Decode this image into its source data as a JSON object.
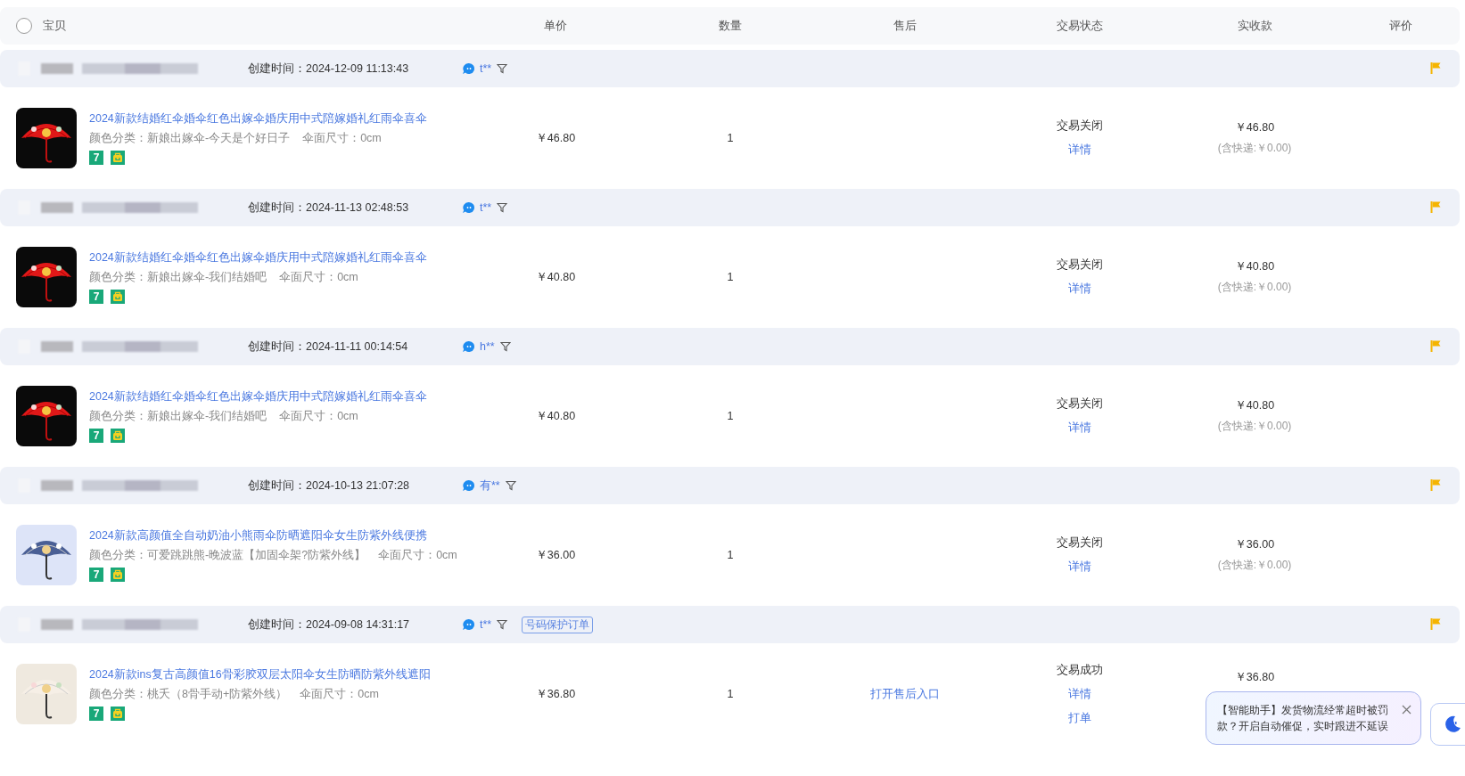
{
  "header": {
    "select_all": {
      "checked": false
    },
    "columns": [
      "宝贝",
      "单价",
      "数量",
      "售后",
      "交易状态",
      "实收款",
      "评价"
    ]
  },
  "orders": [
    {
      "created": "创建时间：2024-12-09 11:13:43",
      "buyer": "t**",
      "item": {
        "thumbnail": {
          "kind": "red"
        },
        "title": "2024新款结婚红伞婚伞红色出嫁伞婚庆用中式陪嫁婚礼红雨伞喜伞",
        "specs": [
          "颜色分类：新娘出嫁伞-今天是个好日子",
          "伞面尺寸：0cm"
        ],
        "badge": "7",
        "price": "￥46.80",
        "qty": "1",
        "status": "交易关闭",
        "actions": [
          "详情"
        ],
        "total": "￥46.80",
        "shipping": "(含快递:￥0.00)"
      }
    },
    {
      "created": "创建时间：2024-11-13 02:48:53",
      "buyer": "t**",
      "item": {
        "thumbnail": {
          "kind": "red"
        },
        "title": "2024新款结婚红伞婚伞红色出嫁伞婚庆用中式陪嫁婚礼红雨伞喜伞",
        "specs": [
          "颜色分类：新娘出嫁伞-我们结婚吧",
          "伞面尺寸：0cm"
        ],
        "badge": "7",
        "price": "￥40.80",
        "qty": "1",
        "status": "交易关闭",
        "actions": [
          "详情"
        ],
        "total": "￥40.80",
        "shipping": "(含快递:￥0.00)"
      }
    },
    {
      "created": "创建时间：2024-11-11 00:14:54",
      "buyer": "h**",
      "item": {
        "thumbnail": {
          "kind": "red"
        },
        "title": "2024新款结婚红伞婚伞红色出嫁伞婚庆用中式陪嫁婚礼红雨伞喜伞",
        "specs": [
          "颜色分类：新娘出嫁伞-我们结婚吧",
          "伞面尺寸：0cm"
        ],
        "badge": "7",
        "price": "￥40.80",
        "qty": "1",
        "status": "交易关闭",
        "actions": [
          "详情"
        ],
        "total": "￥40.80",
        "shipping": "(含快递:￥0.00)"
      }
    },
    {
      "created": "创建时间：2024-10-13 21:07:28",
      "buyer": "有**",
      "item": {
        "thumbnail": {
          "kind": "blue"
        },
        "title": "2024新款高颜值全自动奶油小熊雨伞防晒遮阳伞女生防紫外线便携",
        "specs": [
          "颜色分类：可爱跳跳熊-晚波蓝【加固伞架?防紫外线】",
          "伞面尺寸：0cm"
        ],
        "badge": "7",
        "price": "￥36.00",
        "qty": "1",
        "status": "交易关闭",
        "actions": [
          "详情"
        ],
        "total": "￥36.00",
        "shipping": "(含快递:￥0.00)"
      }
    },
    {
      "created": "创建时间：2024-09-08 14:31:17",
      "buyer": "t**",
      "tag": "号码保护订单",
      "item": {
        "thumbnail": {
          "kind": "cream"
        },
        "title": "2024新款ins复古高颜值16骨彩胶双层太阳伞女生防晒防紫外线遮阳",
        "specs": [
          "颜色分类：桃夭（8骨手动+防紫外线）",
          "伞面尺寸：0cm"
        ],
        "badge": "7",
        "price": "￥36.80",
        "qty": "1",
        "after_sale": "打开售后入口",
        "status": "交易成功",
        "actions": [
          "详情",
          "打单"
        ],
        "total": "￥36.80"
      }
    }
  ],
  "assistant_popup": {
    "text": "【智能助手】发货物流经常超时被罚款？开启自动催促，实时跟进不延误"
  }
}
